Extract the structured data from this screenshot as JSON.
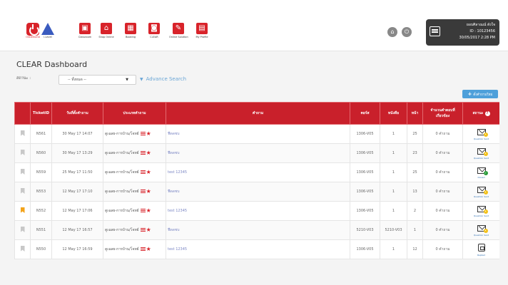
{
  "header": {
    "logos": [
      {
        "label": "OnDemand",
        "kind": "power"
      },
      {
        "label": "i-Level",
        "kind": "triangle"
      }
    ],
    "nav": [
      {
        "label": "Classroom",
        "icon": "presentation-icon"
      },
      {
        "label": "Shop Online",
        "icon": "shop-icon"
      },
      {
        "label": "Booking",
        "icon": "calendar-icon"
      },
      {
        "label": "CLEAR",
        "icon": "clear-icon"
      },
      {
        "label": "Online Solution",
        "icon": "edit-icon"
      },
      {
        "label": "My Profile",
        "icon": "profile-icon"
      }
    ],
    "user": {
      "name": "ยอบศิลาณณ์ ดังใจ",
      "id": "ID : 10123456",
      "datetime": "30/05/2017 2:28 PM"
    }
  },
  "page": {
    "title": "CLEAR Dashboard",
    "status_label": "สถานะ :",
    "status_value": "-- ทั้งหมด --",
    "advance_search": "Advance Search",
    "new_question": "ตั้งคำถามใหม่"
  },
  "table": {
    "headers": {
      "ticket": "TicketID",
      "date": "วันที่ตั้งคำถาม",
      "type": "ประเภทคำถาม",
      "question": "คำถาม",
      "course": "คอร์ส",
      "book": "หนังสือ",
      "page": "หน้า",
      "count": "จำนวนคำตอบที่เกี่ยวข้อง",
      "status": "สถานะ"
    },
    "rows": [
      {
        "flag": false,
        "ticket": "N561",
        "date": "30 May 17 14:07",
        "type": "ดูเฉลย-การบ้าน/โจทย์",
        "question": "ฟืดดชบ",
        "course": "1306-V05",
        "book": "1",
        "page": "25",
        "count": "0 คำถาม",
        "status": "envelope-wait",
        "status_text": "Question Sent"
      },
      {
        "flag": false,
        "ticket": "N560",
        "date": "30 May 17 13:29",
        "type": "ดูเฉลย-การบ้าน/โจทย์",
        "question": "ฟืดดชบ",
        "course": "1306-V05",
        "book": "1",
        "page": "23",
        "count": "0 คำถาม",
        "status": "envelope-wait",
        "status_text": "Question Sent"
      },
      {
        "flag": false,
        "ticket": "N559",
        "date": "25 May 17 11:50",
        "type": "ดูเฉลย-การบ้าน/โจทย์",
        "question": "test 12345",
        "course": "1306-V05",
        "book": "1",
        "page": "25",
        "count": "0 คำถาม",
        "status": "envelope-closed",
        "status_text": "Closed"
      },
      {
        "flag": false,
        "ticket": "N553",
        "date": "12 May 17 17:10",
        "type": "ดูเฉลย-การบ้าน/โจทย์",
        "question": "ฟืดดชบ",
        "course": "1306-V05",
        "book": "1",
        "page": "13",
        "count": "0 คำถาม",
        "status": "envelope-wait",
        "status_text": "Question Sent"
      },
      {
        "flag": true,
        "ticket": "N552",
        "date": "12 May 17 17:06",
        "type": "ดูเฉลย-การบ้าน/โจทย์",
        "question": "test 12345",
        "course": "1306-V05",
        "book": "1",
        "page": "2",
        "count": "0 คำถาม",
        "status": "envelope-wait",
        "status_text": "Question Sent"
      },
      {
        "flag": false,
        "ticket": "N551",
        "date": "12 May 17 16:57",
        "type": "ดูเฉลย-การบ้าน/โจทย์",
        "question": "ฟืดดชบ",
        "course": "5210-V03",
        "book": "5210-V03",
        "page": "1",
        "count": "0 คำถาม",
        "status": "envelope-wait",
        "status_text": "Question Sent"
      },
      {
        "flag": false,
        "ticket": "N550",
        "date": "12 May 17 16:59",
        "type": "ดูเฉลย-การบ้าน/โจทย์",
        "question": "test 12345",
        "course": "1306-V05",
        "book": "1",
        "page": "12",
        "count": "0 คำถาม",
        "status": "replied",
        "status_text": "Replied"
      }
    ]
  }
}
